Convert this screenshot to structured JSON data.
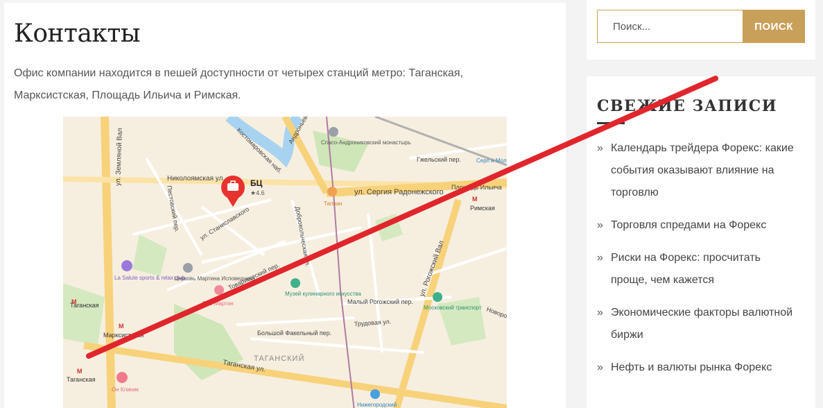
{
  "content": {
    "title": "Контакты",
    "intro_line1": "Офис компании находится в пешей доступности от четырех станций метро: Таганская,",
    "intro_line2": "Марксистская, Площадь Ильича и Римская."
  },
  "search": {
    "placeholder": "Поиск...",
    "button_label": "ПОИСК"
  },
  "recent_posts": {
    "title": "СВЕЖИЕ ЗАПИСИ",
    "items": [
      {
        "line1": "Календарь трейдера Форекс: какие",
        "line2": "события оказывают влияние на",
        "line3": "торговлю"
      },
      {
        "line1": "Торговля спредами на Форекс"
      },
      {
        "line1": "Риски на Форекс: просчитать",
        "line2": "проще, чем кажется"
      },
      {
        "line1": "Экономические факторы валютной",
        "line2": "биржи"
      },
      {
        "line1": "Нефть и валюты рынка Форекс"
      }
    ]
  },
  "map": {
    "marker_label": "БЦ",
    "marker_rating": "★4.6",
    "streets": [
      "Николоямская ул.",
      "ул. Сергия Радонежского",
      "Таганская ул.",
      "ул. Станиславского",
      "Товарищеский пер.",
      "Малый Рогожский пер.",
      "Трудовая ул.",
      "Большой Факельный пер.",
      "ул. Земляной Вал",
      "ул. Рогожский Вал",
      "Костомаровская наб.",
      "Андроньевская",
      "Добровольческая ул.",
      "Пестовский пер.",
      "Гжельский пер.",
      "Площадь Ильича",
      "Новорогожская ул."
    ],
    "places": [
      "Спасо-Андрониковский монастырь",
      "Тапнан",
      "La Salute sports & relax club",
      "Церковь Мартина Исповедника",
      "Дом Мартин",
      "Музей кулинарного искусства",
      "Московский транспорт",
      "Он Клиник",
      "Нижегородский",
      "Серп и Мол"
    ],
    "stations": [
      "Таганская",
      "Марксистская",
      "Таганская",
      "Римская"
    ],
    "district": "ТАГАНСКИЙ"
  }
}
